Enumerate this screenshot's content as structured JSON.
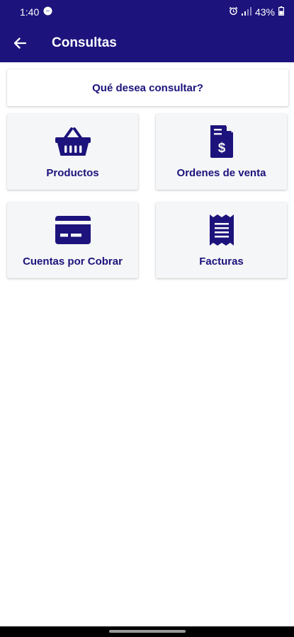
{
  "status_bar": {
    "time": "1:40",
    "battery": "43%"
  },
  "app_bar": {
    "title": "Consultas"
  },
  "prompt": "Qué desea consultar?",
  "tiles": [
    {
      "label": "Productos",
      "icon": "basket-icon"
    },
    {
      "label": "Ordenes de venta",
      "icon": "invoice-dollar-icon"
    },
    {
      "label": "Cuentas por Cobrar",
      "icon": "credit-card-icon"
    },
    {
      "label": "Facturas",
      "icon": "receipt-icon"
    }
  ],
  "colors": {
    "primary": "#1c137c",
    "tile_background": "#f5f6f7"
  }
}
